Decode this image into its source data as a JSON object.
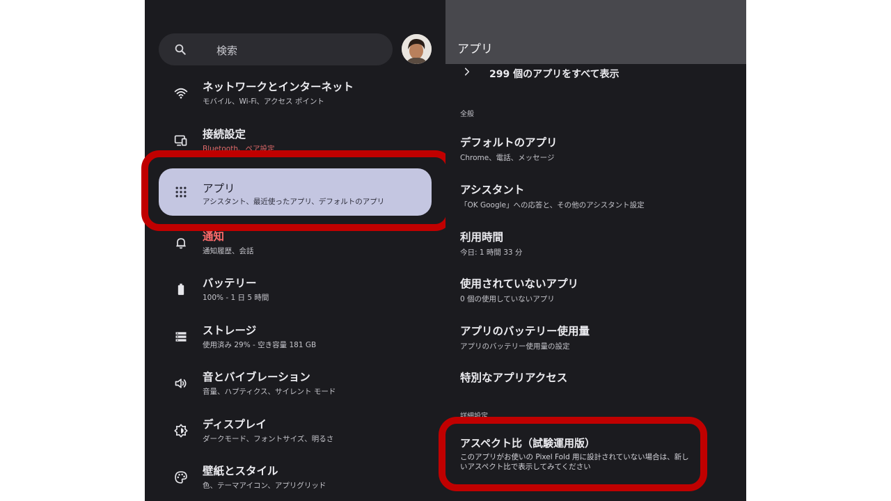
{
  "left_panel": {
    "search": {
      "placeholder": "検索",
      "icon": "search-icon"
    },
    "avatar": "avatar",
    "items": [
      {
        "title": "ネットワークとインターネット",
        "subtitle": "モバイル、Wi-Fi、アクセス ポイント",
        "icon": "wifi-icon"
      },
      {
        "title": "接続設定",
        "subtitle": "Bluetooth、ペア設定",
        "icon": "connected-devices-icon"
      },
      {
        "title": "アプリ",
        "subtitle": "アシスタント、最近使ったアプリ、デフォルトのアプリ",
        "icon": "apps-grid-icon"
      },
      {
        "title": "通知",
        "subtitle": "通知履歴、会話",
        "icon": "bell-icon"
      },
      {
        "title": "バッテリー",
        "subtitle": "100% - 1 日 5 時間",
        "icon": "battery-icon"
      },
      {
        "title": "ストレージ",
        "subtitle": "使用済み 29% - 空き容量 181 GB",
        "icon": "storage-icon"
      },
      {
        "title": "音とバイブレーション",
        "subtitle": "音量、ハプティクス、サイレント モード",
        "icon": "volume-icon"
      },
      {
        "title": "ディスプレイ",
        "subtitle": "ダークモード、フォントサイズ、明るさ",
        "icon": "brightness-icon"
      },
      {
        "title": "壁紙とスタイル",
        "subtitle": "色、テーマアイコン、アプリグリッド",
        "icon": "palette-icon"
      }
    ]
  },
  "right_panel": {
    "title": "アプリ",
    "show_all": "299 個のアプリをすべて表示",
    "section_general": "全般",
    "items": [
      {
        "title": "デフォルトのアプリ",
        "subtitle": "Chrome、電話、メッセージ"
      },
      {
        "title": "アシスタント",
        "subtitle": "「OK Google」への応答と、その他のアシスタント設定"
      },
      {
        "title": "利用時間",
        "subtitle": "今日: 1 時間 33 分"
      },
      {
        "title": "使用されていないアプリ",
        "subtitle": "0 個の使用していないアプリ"
      },
      {
        "title": "アプリのバッテリー使用量",
        "subtitle": "アプリのバッテリー使用量の設定"
      },
      {
        "title": "特別なアプリアクセス",
        "subtitle": ""
      }
    ],
    "section_advanced": "詳細設定",
    "aspect": {
      "title": "アスペクト比（試験運用版）",
      "subtitle": "このアプリがお使いの Pixel Fold 用に設計されていない場合は、新しいアスペクト比で表示してみてください"
    }
  },
  "colors": {
    "background": "#1b1b1f",
    "active_item": "#c4c6e1",
    "header": "#48484d",
    "highlight": "#c00000"
  }
}
